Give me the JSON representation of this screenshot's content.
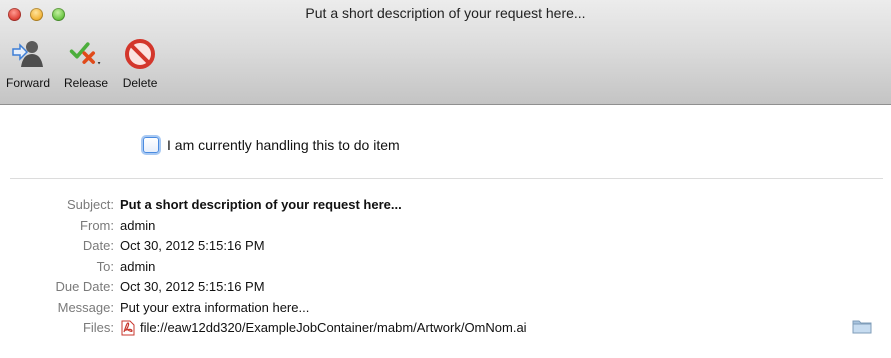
{
  "window": {
    "title": "Put a short description of your request here..."
  },
  "toolbar": {
    "forward_label": "Forward",
    "release_label": "Release",
    "delete_label": "Delete"
  },
  "handling": {
    "label": "I am currently handling this to do item",
    "checked": false
  },
  "fields": {
    "subject": {
      "label": "Subject:",
      "value": "Put a short description of your request here..."
    },
    "from": {
      "label": "From:",
      "value": "admin"
    },
    "date": {
      "label": "Date:",
      "value": "Oct 30, 2012 5:15:16 PM"
    },
    "to": {
      "label": "To:",
      "value": "admin"
    },
    "due_date": {
      "label": "Due Date:",
      "value": "Oct 30, 2012 5:15:16 PM"
    },
    "message": {
      "label": "Message:",
      "value": "Put your extra information here..."
    },
    "files": {
      "label": "Files:",
      "value": "file://eaw12dd320/ExampleJobContainer/mabm/Artwork/OmNom.ai"
    }
  },
  "icons": {
    "forward": "person-forward-icon",
    "release": "check-x-icon",
    "delete": "prohibited-icon",
    "file": "pdf-icon",
    "reveal": "folder-icon"
  }
}
